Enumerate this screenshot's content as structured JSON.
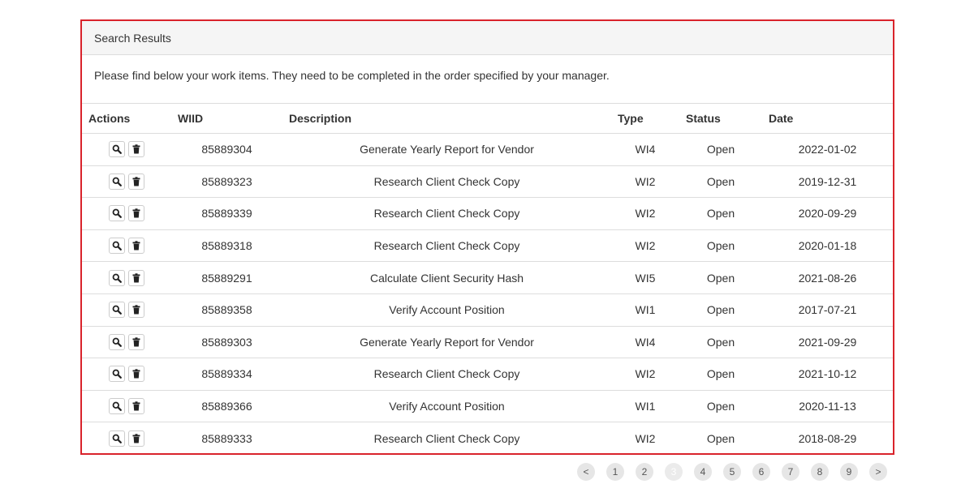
{
  "panel": {
    "heading": "Search Results",
    "body_text": "Please find below your work items. They need to be completed in the order specified by your manager."
  },
  "table": {
    "headers": [
      "Actions",
      "WIID",
      "Description",
      "Type",
      "Status",
      "Date"
    ],
    "rows": [
      {
        "wiid": "85889304",
        "description": "Generate Yearly Report for Vendor",
        "type": "WI4",
        "status": "Open",
        "date": "2022-01-02"
      },
      {
        "wiid": "85889323",
        "description": "Research Client Check Copy",
        "type": "WI2",
        "status": "Open",
        "date": "2019-12-31"
      },
      {
        "wiid": "85889339",
        "description": "Research Client Check Copy",
        "type": "WI2",
        "status": "Open",
        "date": "2020-09-29"
      },
      {
        "wiid": "85889318",
        "description": "Research Client Check Copy",
        "type": "WI2",
        "status": "Open",
        "date": "2020-01-18"
      },
      {
        "wiid": "85889291",
        "description": "Calculate Client Security Hash",
        "type": "WI5",
        "status": "Open",
        "date": "2021-08-26"
      },
      {
        "wiid": "85889358",
        "description": "Verify Account Position",
        "type": "WI1",
        "status": "Open",
        "date": "2017-07-21"
      },
      {
        "wiid": "85889303",
        "description": "Generate Yearly Report for Vendor",
        "type": "WI4",
        "status": "Open",
        "date": "2021-09-29"
      },
      {
        "wiid": "85889334",
        "description": "Research Client Check Copy",
        "type": "WI2",
        "status": "Open",
        "date": "2021-10-12"
      },
      {
        "wiid": "85889366",
        "description": "Verify Account Position",
        "type": "WI1",
        "status": "Open",
        "date": "2020-11-13"
      },
      {
        "wiid": "85889333",
        "description": "Research Client Check Copy",
        "type": "WI2",
        "status": "Open",
        "date": "2018-08-29"
      }
    ],
    "row_icons": [
      "search-icon",
      "trash-icon"
    ]
  },
  "pagination": {
    "items": [
      "<",
      "1",
      "2",
      "3",
      "4",
      "5",
      "6",
      "7",
      "8",
      "9",
      ">"
    ],
    "active": "3"
  },
  "colors": {
    "panel_border": "#d9232b",
    "heading_bg": "#f5f5f5"
  }
}
